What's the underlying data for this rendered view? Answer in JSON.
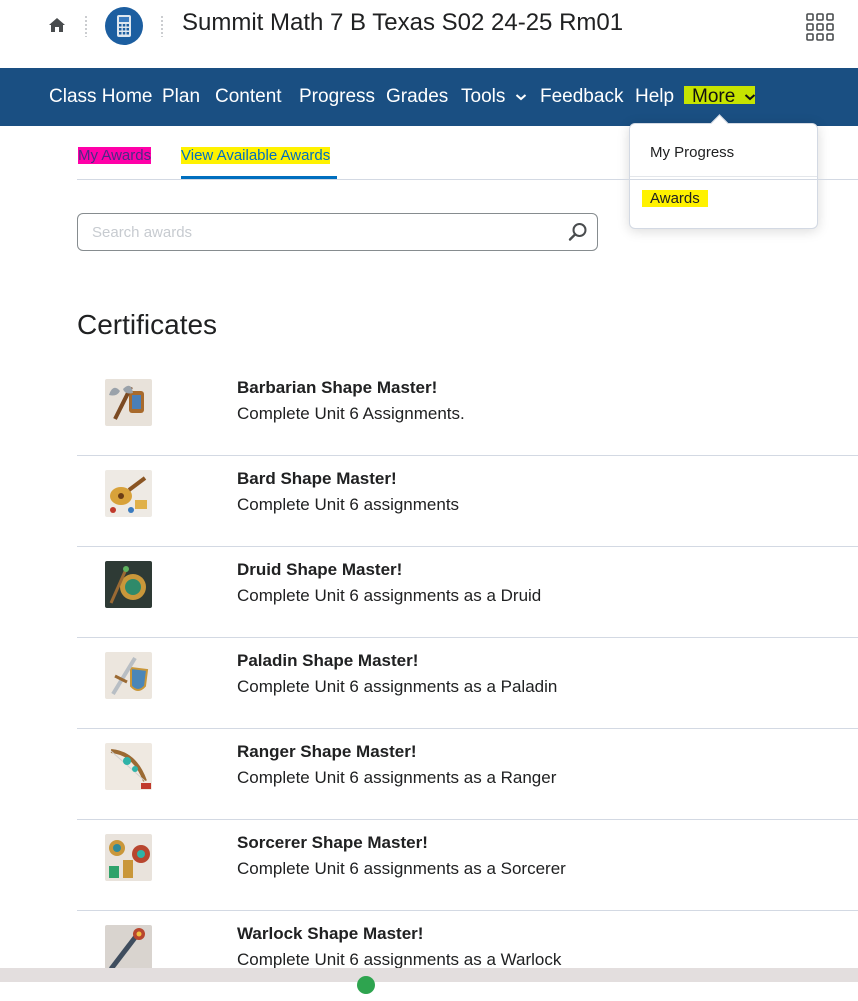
{
  "header": {
    "course_title": "Summit Math 7 B Texas S02 24-25 Rm01",
    "icons": {
      "home": "home-icon",
      "logo": "calculator-icon",
      "apps": "app-grid-icon"
    }
  },
  "nav": {
    "items": [
      {
        "label": "Class Home"
      },
      {
        "label": "Plan"
      },
      {
        "label": "Content"
      },
      {
        "label": "Progress"
      },
      {
        "label": "Grades"
      },
      {
        "label": "Tools"
      },
      {
        "label": "Feedback"
      },
      {
        "label": "Help"
      },
      {
        "label": "More"
      }
    ],
    "highlight_color": "#c6e400",
    "bar_color": "#1a4f82"
  },
  "more_menu": {
    "items": [
      {
        "label": "My Progress"
      },
      {
        "label": "Awards"
      }
    ]
  },
  "subtabs": {
    "my_awards": "My Awards",
    "available_awards": "View Available Awards",
    "active_color": "#006fbf"
  },
  "search": {
    "placeholder": "Search awards"
  },
  "certificates": {
    "title": "Certificates",
    "awards": [
      {
        "name": "Barbarian Shape Master!",
        "description": "Complete Unit 6 Assignments.",
        "image": "barbarian-axe-icon"
      },
      {
        "name": "Bard Shape Master!",
        "description": "Complete Unit 6 assignments",
        "image": "bard-lute-icon"
      },
      {
        "name": "Druid Shape Master!",
        "description": "Complete Unit 6 assignments as a Druid",
        "image": "druid-staff-icon"
      },
      {
        "name": "Paladin Shape Master!",
        "description": "Complete Unit 6 assignments as a Paladin",
        "image": "paladin-sword-icon"
      },
      {
        "name": "Ranger Shape Master!",
        "description": "Complete Unit 6 assignments as a Ranger",
        "image": "ranger-bow-icon"
      },
      {
        "name": "Sorcerer Shape Master!",
        "description": "Complete Unit 6 assignments as a Sorcerer",
        "image": "sorcerer-orb-icon"
      },
      {
        "name": "Warlock Shape Master!",
        "description": "Complete Unit 6 assignments as a Warlock",
        "image": "warlock-staff-icon"
      }
    ]
  }
}
